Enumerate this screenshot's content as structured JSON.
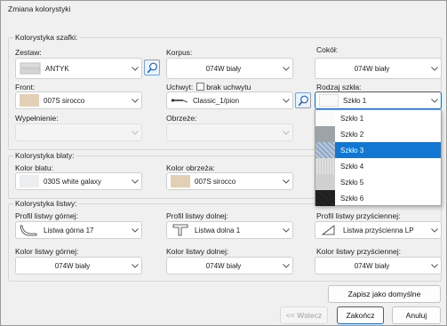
{
  "window": {
    "title": "Zmiana kolorystyki"
  },
  "groups": {
    "szafki": "Kolorystyka szafki:",
    "blaty": "Kolorystyka blaty:",
    "listwy": "Kolorystyka listwy:"
  },
  "labels": {
    "zestaw": "Zestaw:",
    "korpus": "Korpus:",
    "cokol": "Cokół:",
    "front": "Front:",
    "uchwyt": "Uchwyt:",
    "brak_uchwytu": "brak uchwytu",
    "rodzaj_szkla": "Rodzaj szkła:",
    "wypelnienie": "Wypełnienie:",
    "obrzeze": "Obrzeże:",
    "kolor_blatu": "Kolor blatu:",
    "kolor_obrzeza": "Kolor obrzeża:",
    "profil_gornej": "Profil listwy górnej:",
    "profil_dolnej": "Profil listwy dolnej:",
    "profil_przysciennej": "Profil listwy przyściennej:",
    "kolor_gornej": "Kolor listwy górnej:",
    "kolor_dolnej": "Kolor listwy dolnej:",
    "kolor_przysciennej": "Kolor listwy przyściennej:"
  },
  "values": {
    "zestaw": "ANTYK",
    "korpus": "074W biały",
    "cokol": "074W biały",
    "front": "007S sirocco",
    "uchwyt": "Classic_1/pion",
    "rodzaj_szkla": "Szkło 1",
    "wypelnienie": "",
    "obrzeze": "",
    "kolor_blatu": "030S white galaxy",
    "kolor_obrzeza": "007S sirocco",
    "profil_gornej": "Listwa górna 17",
    "profil_dolnej": "Listwa dolna 1",
    "profil_przysciennej": "Listwa przyścienna LP",
    "kolor_gornej": "074W biały",
    "kolor_dolnej": "074W biały",
    "kolor_przysciennej": "074W biały"
  },
  "glass_options": [
    "Szkło 1",
    "Szkło 2",
    "Szkło 3",
    "Szkło 4",
    "Szkło 5",
    "Szkło 6"
  ],
  "glass_selected_index": 2,
  "buttons": {
    "save_default": "Zapisz jako domyślne",
    "back": "<< Wstecz",
    "finish": "Zakończ",
    "cancel": "Anuluj"
  },
  "colors": {
    "sirocco": "#e2cfb4",
    "white_galaxy": "#ecedef",
    "accent": "#1177d3"
  }
}
